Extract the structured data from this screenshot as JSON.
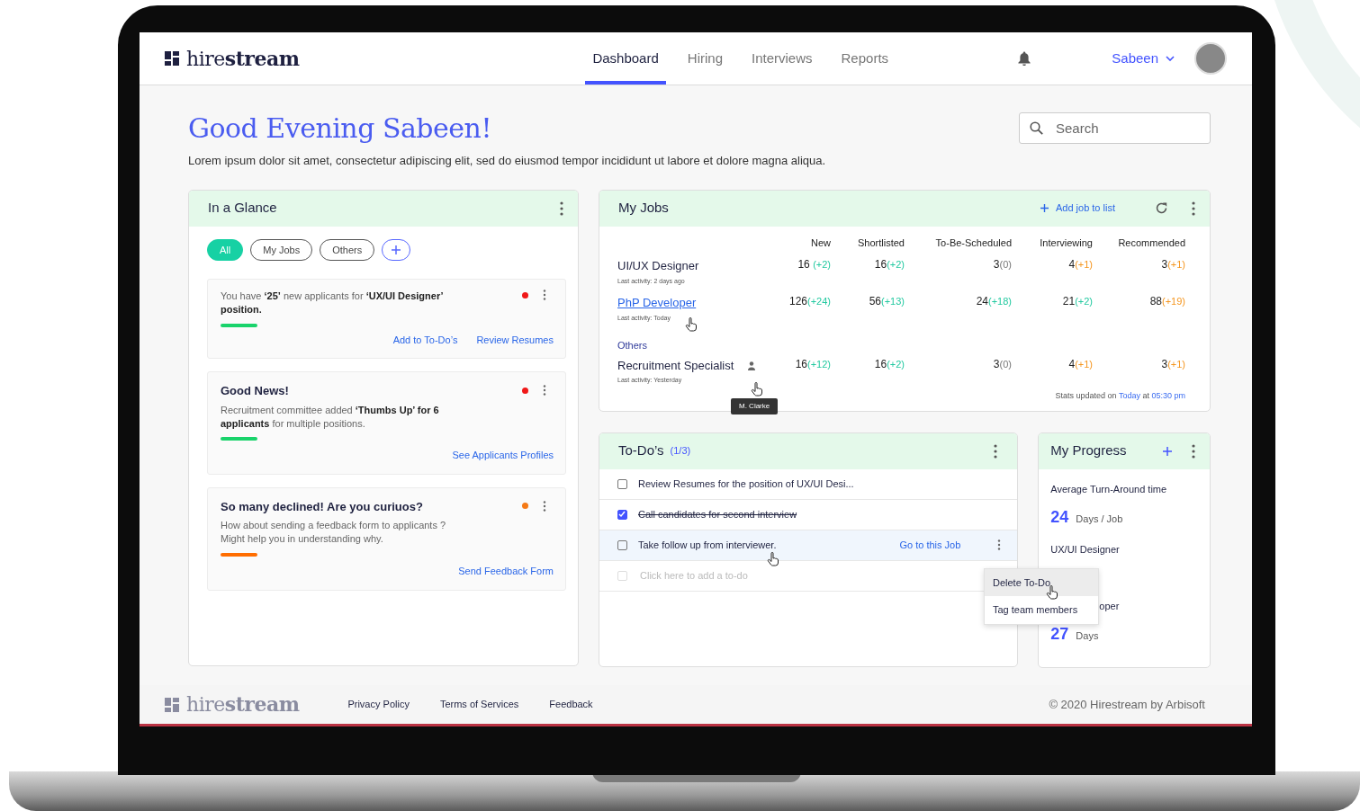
{
  "brand": {
    "logo": "hire**stream**"
  },
  "nav": {
    "tabs": [
      {
        "label": "Dashboard",
        "selected": true
      },
      {
        "label": "Hiring",
        "selected": false
      },
      {
        "label": "Interviews",
        "selected": false
      },
      {
        "label": "Reports",
        "selected": false
      }
    ],
    "user": "Sabeen"
  },
  "greeting": {
    "title": "Good Evening Sabeen!",
    "subtitle": "Lorem ipsum dolor sit amet, consectetur adipiscing elit, sed do eiusmod tempor incididunt ut labore et dolore magna aliqua."
  },
  "search": {
    "placeholder": "Search"
  },
  "glance": {
    "title": "In a Glance",
    "filters": [
      {
        "label": "All",
        "selected": true
      },
      {
        "label": "My Jobs",
        "selected": false
      },
      {
        "label": "Others",
        "selected": false
      }
    ],
    "notifications": [
      {
        "text": "You have **‘25’** new applicants for **‘UX/UI Designer’ position.**",
        "dot": {
          "color": "#f01818"
        },
        "accent": {
          "color": "#19d36b"
        },
        "actions": [
          "Add to To-Do’s",
          "Review Resumes"
        ]
      },
      {
        "title": "Good News!",
        "text": "Recruitment committee added **‘Thumbs Up’ for 6 applicants** for multiple positions.",
        "dot": {
          "color": "#f01818"
        },
        "accent": {
          "color": "#19d36b"
        },
        "actions": [
          "See Applicants Profiles"
        ]
      },
      {
        "title": "So many declined! Are you curiuos?",
        "text": "How about sending a feedback form to applicants ?\nMight help you in understanding why.",
        "dot": {
          "color": "#f57a16"
        },
        "accent": {
          "color": "#ff6d00"
        },
        "actions": [
          "Send Feedback Form"
        ]
      }
    ]
  },
  "my_jobs": {
    "title": "My Jobs",
    "add_label": "Add job to list",
    "columns": [
      "New",
      "Shortlisted",
      "To-Be-Scheduled",
      "Interviewing",
      "Recommended"
    ],
    "rows": [
      {
        "kind": "job",
        "title": "UI/UX Designer",
        "link": false,
        "activity": "Last activity: 2 days ago",
        "cells": [
          {
            "value": "16 ",
            "delta": "(+2)",
            "color": "#22c9a0"
          },
          {
            "value": "16",
            "delta": "(+2)",
            "color": "#22c9a0"
          },
          {
            "value": "3",
            "delta": "(0)",
            "color": "#777777"
          },
          {
            "value": "4",
            "delta": "(+1)",
            "color": "#f5961f"
          },
          {
            "value": "3",
            "delta": "(+1)",
            "color": "#f5961f"
          }
        ]
      },
      {
        "kind": "job",
        "title": "PhP Developer",
        "link": true,
        "activity": "Last activity: Today",
        "cells": [
          {
            "value": "126",
            "delta": "(+24)",
            "color": "#22c9a0"
          },
          {
            "value": "56",
            "delta": "(+13)",
            "color": "#22c9a0"
          },
          {
            "value": "24",
            "delta": "(+18)",
            "color": "#22c9a0"
          },
          {
            "value": "21",
            "delta": "(+2)",
            "color": "#22c9a0"
          },
          {
            "value": "88",
            "delta": "(+19)",
            "color": "#f5961f"
          }
        ]
      },
      {
        "kind": "group",
        "title": "Others"
      },
      {
        "kind": "job",
        "title": "Recruitment Specialist",
        "link": false,
        "assignee_tooltip": "M. Clarke",
        "activity": "Last activity: Yesterday",
        "cells": [
          {
            "value": "16",
            "delta": "(+12)",
            "color": "#22c9a0"
          },
          {
            "value": "16",
            "delta": "(+2)",
            "color": "#22c9a0"
          },
          {
            "value": "3",
            "delta": "(0)",
            "color": "#777777"
          },
          {
            "value": "4",
            "delta": "(+1)",
            "color": "#f5961f"
          },
          {
            "value": "3",
            "delta": "(+1)",
            "color": "#f5961f"
          }
        ]
      }
    ],
    "stats": {
      "prefix": "Stats updated on",
      "day": "Today",
      "mid": "at",
      "time": "05:30 pm"
    }
  },
  "todos": {
    "title": "To-Do’s",
    "count": "(1/3)",
    "items": [
      {
        "text": "Review Resumes for the position of UX/UI Desi...",
        "checked": false,
        "highlighted": false,
        "menu_open": false
      },
      {
        "text": "Call candidates for second interview",
        "checked": true,
        "highlighted": false,
        "menu_open": false
      },
      {
        "text": "Take follow up from interviewer.",
        "checked": false,
        "highlighted": true,
        "action": "Go to this Job",
        "menu_open": true
      }
    ],
    "new_item": {
      "placeholder": "Click here to add a to-do",
      "checked": false
    },
    "menu": [
      {
        "label": "Delete To-Do",
        "highlighted": true
      },
      {
        "label": "Tag team members",
        "highlighted": false
      }
    ]
  },
  "progress": {
    "title": "My Progress",
    "items": [
      {
        "kind": "metric",
        "label": "Average Turn-Around time",
        "value": "24",
        "unit": "Days / Job"
      },
      {
        "kind": "covered",
        "label": "UX/UI Designer"
      },
      {
        "kind": "partial",
        "label": "oper",
        "value": "27",
        "unit": "Days"
      }
    ]
  },
  "footer": {
    "logo": "hire**stream**",
    "links": [
      "Privacy Policy",
      "Terms of Services",
      "Feedback"
    ],
    "copyright": "© 2020 Hirestream by Arbisoft"
  }
}
